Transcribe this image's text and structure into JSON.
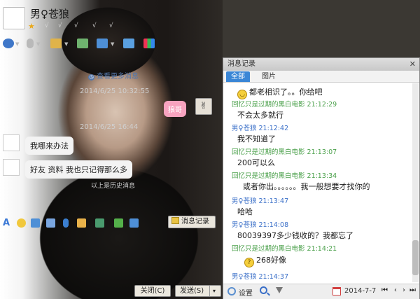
{
  "chat": {
    "nickname": "男♀苍狼",
    "star": "★",
    "ticks": [
      "√",
      "√",
      "√",
      "√",
      "√"
    ],
    "see_more": "查看更多消息",
    "see_more_icon": "clock-icon",
    "timestamp_1": "2014/6/25 10:32:55",
    "timestamp_2": "2014/6/25 16:44",
    "sent_bubble": "狼哥",
    "received_1": "我哪来办法",
    "received_2": "好友 资料 我也只记得那么多",
    "above_info": "以上是历史消息",
    "history_button": "消息记录",
    "close_button": "关闭(C)",
    "send_button": "发送(S)",
    "send_caret": "▾",
    "toolbar_icons": [
      "video-icon",
      "mic-icon",
      "folder-icon",
      "app-icon",
      "screen-icon",
      "image-icon",
      "apps-grid-icon"
    ],
    "format_icons": [
      "font-icon",
      "emoji-icon",
      "shake-icon",
      "screenshot-icon",
      "voice-icon",
      "doodle-icon",
      "photo-icon",
      "music-icon",
      "remote-icon"
    ],
    "colors": {
      "accent_blue": "#3a86d6",
      "pink_bubble": "#f7a3bf"
    }
  },
  "history": {
    "title": "消息记录",
    "close": "✕",
    "tabs": [
      "全部",
      "图片"
    ],
    "messages": [
      {
        "sender": "",
        "color": "none",
        "body": "都老相识了。。你给吧",
        "emoji": true
      },
      {
        "sender": "回忆只是过期的黑白电影 21:12:29",
        "color": "green",
        "body": "不会太多就行",
        "emoji": false
      },
      {
        "sender": "男♀苍狼 21:12:42",
        "color": "blue",
        "body": "我不知道了",
        "emoji": false
      },
      {
        "sender": "回忆只是过期的黑白电影 21:13:07",
        "color": "green",
        "body": "200可以么",
        "emoji": false
      },
      {
        "sender": "回忆只是过期的黑白电影 21:13:34",
        "color": "green",
        "body": "或者你出。。。。。。我一般想要才找你的",
        "emoji": false
      },
      {
        "sender": "男♀苍狼 21:13:47",
        "color": "blue",
        "body": "哈哈",
        "emoji": false
      },
      {
        "sender": "男♀苍狼 21:14:08",
        "color": "blue",
        "body": "80039397多少钱收的？我都忘了",
        "emoji": false
      },
      {
        "sender": "回忆只是过期的黑白电影 21:14:21",
        "color": "green",
        "body": "268好像",
        "emoji": true
      },
      {
        "sender": "男♀苍狼 21:14:37",
        "color": "blue",
        "body": "",
        "emoji": false
      }
    ],
    "footer": {
      "settings": "设置",
      "date": "2014-7-7",
      "nav_first": "⏮",
      "nav_prev": "‹",
      "nav_next": "›",
      "nav_last": "⏭"
    }
  }
}
